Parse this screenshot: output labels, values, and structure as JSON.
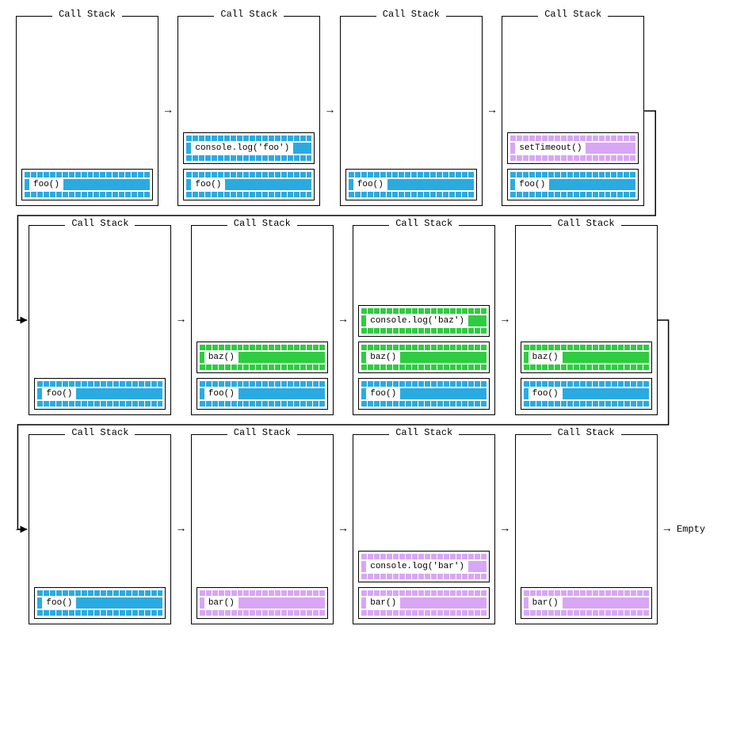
{
  "title": "Call Stack",
  "colors": {
    "blue": "#29abe2",
    "green": "#2ecc40",
    "purple": "#d8a6f5"
  },
  "arrow": "→",
  "empty_label": "Empty",
  "stacks": [
    [
      [
        {
          "label": "foo()",
          "color": "blue"
        }
      ],
      [
        {
          "label": "console.log('foo')",
          "color": "blue"
        },
        {
          "label": "foo()",
          "color": "blue"
        }
      ],
      [
        {
          "label": "foo()",
          "color": "blue"
        }
      ],
      [
        {
          "label": "setTimeout()",
          "color": "purple"
        },
        {
          "label": "foo()",
          "color": "blue"
        }
      ]
    ],
    [
      [
        {
          "label": "foo()",
          "color": "blue"
        }
      ],
      [
        {
          "label": "baz()",
          "color": "green"
        },
        {
          "label": "foo()",
          "color": "blue"
        }
      ],
      [
        {
          "label": "console.log('baz')",
          "color": "green"
        },
        {
          "label": "baz()",
          "color": "green"
        },
        {
          "label": "foo()",
          "color": "blue"
        }
      ],
      [
        {
          "label": "baz()",
          "color": "green"
        },
        {
          "label": "foo()",
          "color": "blue"
        }
      ]
    ],
    [
      [
        {
          "label": "foo()",
          "color": "blue"
        }
      ],
      [
        {
          "label": "bar()",
          "color": "purple"
        }
      ],
      [
        {
          "label": "console.log('bar')",
          "color": "purple"
        },
        {
          "label": "bar()",
          "color": "purple"
        }
      ],
      [
        {
          "label": "bar()",
          "color": "purple"
        }
      ]
    ]
  ]
}
